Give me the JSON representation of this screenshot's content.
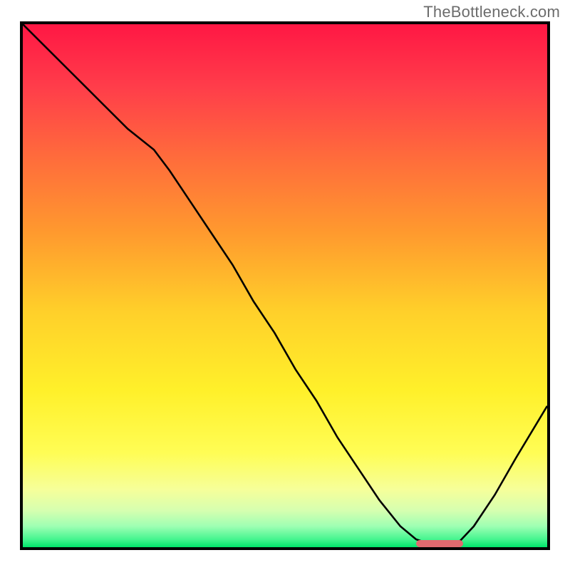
{
  "watermark": "TheBottleneck.com",
  "chart_data": {
    "type": "line",
    "title": "",
    "xlabel": "",
    "ylabel": "",
    "xlim": [
      0,
      100
    ],
    "ylim": [
      0,
      100
    ],
    "grid": false,
    "series": [
      {
        "name": "bottleneck-curve",
        "x": [
          0,
          5,
          10,
          15,
          20,
          25,
          28,
          32,
          36,
          40,
          44,
          48,
          52,
          56,
          60,
          64,
          68,
          72,
          75,
          78,
          81,
          83,
          86,
          90,
          94,
          100
        ],
        "y": [
          100,
          95,
          90,
          85,
          80,
          76,
          72,
          66,
          60,
          54,
          47,
          41,
          34,
          28,
          21,
          15,
          9,
          4,
          1.5,
          0.5,
          0.5,
          0.8,
          4,
          10,
          17,
          27
        ]
      }
    ],
    "optimal_marker": {
      "x_start": 75,
      "x_end": 84,
      "y": 0.5,
      "color": "#e16a6f"
    },
    "gradient_stops": [
      {
        "pct": 0,
        "color": "#ff1744"
      },
      {
        "pct": 12,
        "color": "#ff3d4a"
      },
      {
        "pct": 25,
        "color": "#ff6a3c"
      },
      {
        "pct": 40,
        "color": "#ff9a2e"
      },
      {
        "pct": 55,
        "color": "#ffd02a"
      },
      {
        "pct": 70,
        "color": "#fff02a"
      },
      {
        "pct": 82,
        "color": "#fffd55"
      },
      {
        "pct": 89,
        "color": "#f6ff9a"
      },
      {
        "pct": 93,
        "color": "#d6ffb0"
      },
      {
        "pct": 96,
        "color": "#9effb3"
      },
      {
        "pct": 98.5,
        "color": "#45f58f"
      },
      {
        "pct": 100,
        "color": "#00e46a"
      }
    ]
  }
}
